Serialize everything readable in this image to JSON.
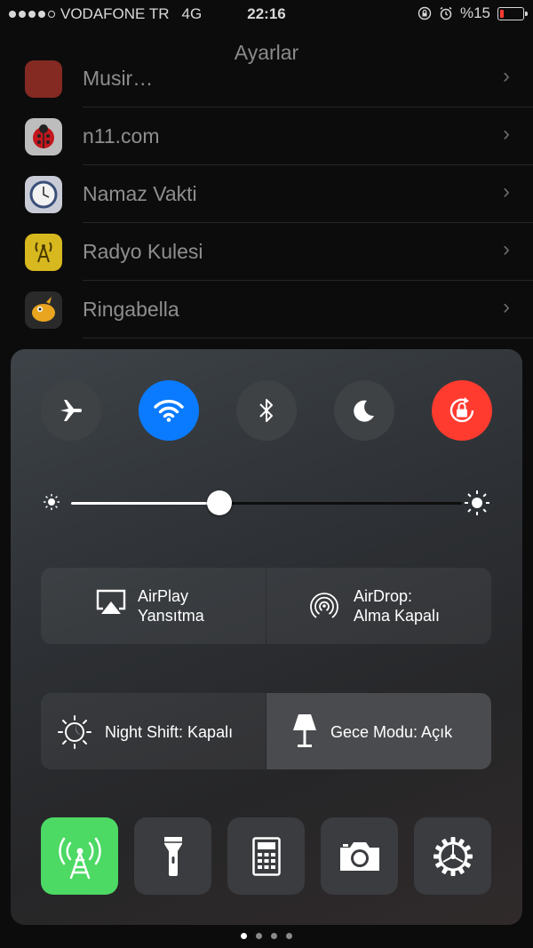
{
  "status_bar": {
    "carrier": "VODAFONE TR",
    "network": "4G",
    "time": "22:16",
    "battery_text": "%15",
    "battery_level_percent": 15,
    "signal_bars_filled": 4,
    "signal_bars_total": 5
  },
  "nav": {
    "title": "Ayarlar"
  },
  "settings_list": {
    "items": [
      {
        "label": "Musir…",
        "icon": "red-app-icon"
      },
      {
        "label": "n11.com",
        "icon": "ladybug-icon"
      },
      {
        "label": "Namaz Vakti",
        "icon": "clock-icon"
      },
      {
        "label": "Radyo Kulesi",
        "icon": "radio-tower-icon"
      },
      {
        "label": "Ringabella",
        "icon": "bird-icon"
      }
    ]
  },
  "control_center": {
    "toggles": [
      {
        "name": "airplane-mode",
        "icon": "airplane-icon",
        "state": "off"
      },
      {
        "name": "wifi",
        "icon": "wifi-icon",
        "state": "on"
      },
      {
        "name": "bluetooth",
        "icon": "bluetooth-icon",
        "state": "off"
      },
      {
        "name": "do-not-disturb",
        "icon": "moon-icon",
        "state": "off"
      },
      {
        "name": "rotation-lock",
        "icon": "rotation-lock-icon",
        "state": "on"
      }
    ],
    "brightness_fraction": 0.38,
    "airplay": {
      "line1": "AirPlay",
      "line2": "Yansıtma"
    },
    "airdrop": {
      "line1": "AirDrop:",
      "line2": "Alma Kapalı"
    },
    "night_shift": {
      "label": "Night Shift: Kapalı"
    },
    "night_mode": {
      "label": "Gece Modu: Açık"
    },
    "shortcuts": [
      {
        "name": "cellular-data",
        "icon": "antenna-icon"
      },
      {
        "name": "flashlight",
        "icon": "flashlight-icon"
      },
      {
        "name": "calculator",
        "icon": "calculator-icon"
      },
      {
        "name": "camera",
        "icon": "camera-icon"
      },
      {
        "name": "settings",
        "icon": "gear-icon"
      }
    ]
  },
  "page_indicator": {
    "pages": 4,
    "current": 1
  },
  "colors": {
    "accent_blue": "#0a7bff",
    "accent_red": "#ff3b30",
    "accent_green": "#4cd964",
    "battery_red": "#ff3b30"
  }
}
